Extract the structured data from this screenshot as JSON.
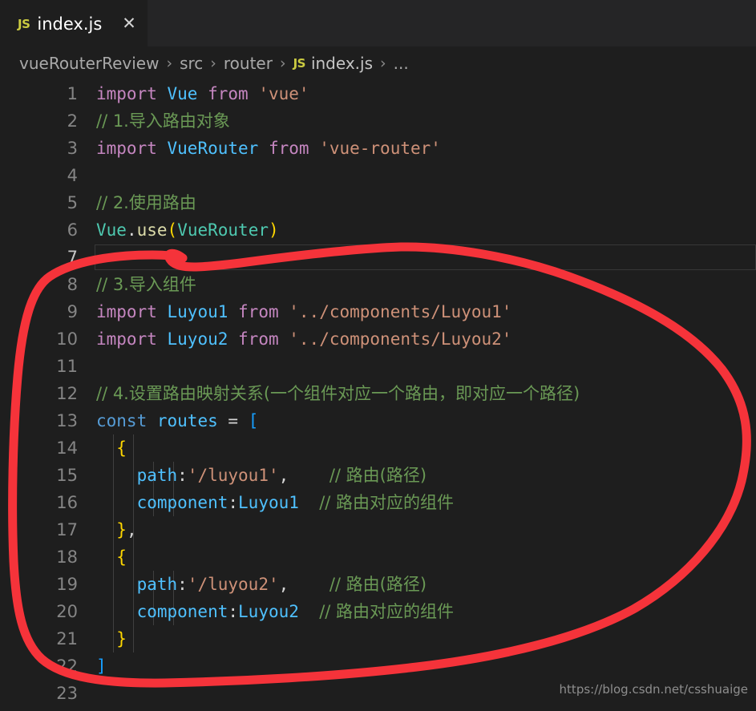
{
  "window": {
    "app": "Visual Studio Code",
    "theme_background": "#1e1e1e"
  },
  "tab": {
    "icon_label": "JS",
    "title": "index.js",
    "close_glyph": "✕"
  },
  "breadcrumb": {
    "items": [
      "vueRouterReview",
      "src",
      "router"
    ],
    "separator": "›",
    "file_icon_label": "JS",
    "file": "index.js",
    "ellipsis": "..."
  },
  "editor": {
    "active_line": 7,
    "lines": [
      {
        "n": "1",
        "tokens": [
          {
            "t": "import",
            "c": "t-kw"
          },
          {
            "t": " ",
            "c": "t-pun"
          },
          {
            "t": "Vue",
            "c": "t-var"
          },
          {
            "t": " ",
            "c": "t-pun"
          },
          {
            "t": "from",
            "c": "t-kw"
          },
          {
            "t": " ",
            "c": "t-pun"
          },
          {
            "t": "'vue'",
            "c": "t-str"
          }
        ],
        "guides": []
      },
      {
        "n": "2",
        "tokens": [
          {
            "t": "// 1.导入路由对象",
            "c": "t-cmt"
          }
        ],
        "guides": []
      },
      {
        "n": "3",
        "tokens": [
          {
            "t": "import",
            "c": "t-kw"
          },
          {
            "t": " ",
            "c": "t-pun"
          },
          {
            "t": "VueRouter",
            "c": "t-var"
          },
          {
            "t": " ",
            "c": "t-pun"
          },
          {
            "t": "from",
            "c": "t-kw"
          },
          {
            "t": " ",
            "c": "t-pun"
          },
          {
            "t": "'vue-router'",
            "c": "t-str"
          }
        ],
        "guides": []
      },
      {
        "n": "4",
        "tokens": [],
        "guides": []
      },
      {
        "n": "5",
        "tokens": [
          {
            "t": "// 2.使用路由",
            "c": "t-cmt"
          }
        ],
        "guides": []
      },
      {
        "n": "6",
        "tokens": [
          {
            "t": "Vue",
            "c": "t-type"
          },
          {
            "t": ".",
            "c": "t-pun"
          },
          {
            "t": "use",
            "c": "t-fn"
          },
          {
            "t": "(",
            "c": "t-brk"
          },
          {
            "t": "VueRouter",
            "c": "t-type"
          },
          {
            "t": ")",
            "c": "t-brk"
          }
        ],
        "guides": []
      },
      {
        "n": "7",
        "tokens": [],
        "guides": []
      },
      {
        "n": "8",
        "tokens": [
          {
            "t": "// 3.导入组件",
            "c": "t-cmt"
          }
        ],
        "guides": []
      },
      {
        "n": "9",
        "tokens": [
          {
            "t": "import",
            "c": "t-kw"
          },
          {
            "t": " ",
            "c": "t-pun"
          },
          {
            "t": "Luyou1",
            "c": "t-var"
          },
          {
            "t": " ",
            "c": "t-pun"
          },
          {
            "t": "from",
            "c": "t-kw"
          },
          {
            "t": " ",
            "c": "t-pun"
          },
          {
            "t": "'../components/Luyou1'",
            "c": "t-str"
          }
        ],
        "guides": []
      },
      {
        "n": "10",
        "tokens": [
          {
            "t": "import",
            "c": "t-kw"
          },
          {
            "t": " ",
            "c": "t-pun"
          },
          {
            "t": "Luyou2",
            "c": "t-var"
          },
          {
            "t": " ",
            "c": "t-pun"
          },
          {
            "t": "from",
            "c": "t-kw"
          },
          {
            "t": " ",
            "c": "t-pun"
          },
          {
            "t": "'../components/Luyou2'",
            "c": "t-str"
          }
        ],
        "guides": []
      },
      {
        "n": "11",
        "tokens": [],
        "guides": []
      },
      {
        "n": "12",
        "tokens": [
          {
            "t": "// 4.设置路由映射关系(一个组件对应一个路由，即对应一个路径)",
            "c": "t-cmt"
          }
        ],
        "guides": []
      },
      {
        "n": "13",
        "tokens": [
          {
            "t": "const",
            "c": "t-ctl"
          },
          {
            "t": " ",
            "c": "t-pun"
          },
          {
            "t": "routes",
            "c": "t-var"
          },
          {
            "t": " ",
            "c": "t-pun"
          },
          {
            "t": "=",
            "c": "t-pun"
          },
          {
            "t": " ",
            "c": "t-pun"
          },
          {
            "t": "[",
            "c": "t-brk3"
          }
        ],
        "guides": []
      },
      {
        "n": "14",
        "tokens": [
          {
            "t": "  ",
            "c": "t-pun"
          },
          {
            "t": "{",
            "c": "t-brk"
          }
        ],
        "guides": [
          23,
          48
        ]
      },
      {
        "n": "15",
        "tokens": [
          {
            "t": "    ",
            "c": "t-pun"
          },
          {
            "t": "path",
            "c": "t-var"
          },
          {
            "t": ":",
            "c": "t-pun"
          },
          {
            "t": "'/luyou1'",
            "c": "t-str"
          },
          {
            "t": ",",
            "c": "t-pun"
          },
          {
            "t": "    ",
            "c": "t-pun"
          },
          {
            "t": "// 路由(路径)",
            "c": "t-cmt"
          }
        ],
        "guides": [
          23,
          48,
          73,
          98
        ]
      },
      {
        "n": "16",
        "tokens": [
          {
            "t": "    ",
            "c": "t-pun"
          },
          {
            "t": "component",
            "c": "t-var"
          },
          {
            "t": ":",
            "c": "t-pun"
          },
          {
            "t": "Luyou1",
            "c": "t-var"
          },
          {
            "t": "  ",
            "c": "t-pun"
          },
          {
            "t": "// 路由对应的组件",
            "c": "t-cmt"
          }
        ],
        "guides": [
          23,
          48,
          73,
          98
        ]
      },
      {
        "n": "17",
        "tokens": [
          {
            "t": "  ",
            "c": "t-pun"
          },
          {
            "t": "}",
            "c": "t-brk"
          },
          {
            "t": ",",
            "c": "t-pun"
          }
        ],
        "guides": [
          23,
          48
        ]
      },
      {
        "n": "18",
        "tokens": [
          {
            "t": "  ",
            "c": "t-pun"
          },
          {
            "t": "{",
            "c": "t-brk"
          }
        ],
        "guides": [
          23,
          48
        ]
      },
      {
        "n": "19",
        "tokens": [
          {
            "t": "    ",
            "c": "t-pun"
          },
          {
            "t": "path",
            "c": "t-var"
          },
          {
            "t": ":",
            "c": "t-pun"
          },
          {
            "t": "'/luyou2'",
            "c": "t-str"
          },
          {
            "t": ",",
            "c": "t-pun"
          },
          {
            "t": "    ",
            "c": "t-pun"
          },
          {
            "t": "// 路由(路径)",
            "c": "t-cmt"
          }
        ],
        "guides": [
          23,
          48,
          73,
          98
        ]
      },
      {
        "n": "20",
        "tokens": [
          {
            "t": "    ",
            "c": "t-pun"
          },
          {
            "t": "component",
            "c": "t-var"
          },
          {
            "t": ":",
            "c": "t-pun"
          },
          {
            "t": "Luyou2",
            "c": "t-var"
          },
          {
            "t": "  ",
            "c": "t-pun"
          },
          {
            "t": "// 路由对应的组件",
            "c": "t-cmt"
          }
        ],
        "guides": [
          23,
          48,
          73,
          98
        ]
      },
      {
        "n": "21",
        "tokens": [
          {
            "t": "  ",
            "c": "t-pun"
          },
          {
            "t": "}",
            "c": "t-brk"
          }
        ],
        "guides": [
          23,
          48
        ]
      },
      {
        "n": "22",
        "tokens": [
          {
            "t": "]",
            "c": "t-brk3"
          }
        ],
        "guides": []
      },
      {
        "n": "23",
        "tokens": [],
        "guides": []
      }
    ]
  },
  "annotation": {
    "type": "freehand-circle",
    "color": "#f5333a",
    "stroke_width": 11,
    "encloses_lines": "8-23"
  },
  "watermark": {
    "text": "https://blog.csdn.net/csshuaige"
  }
}
